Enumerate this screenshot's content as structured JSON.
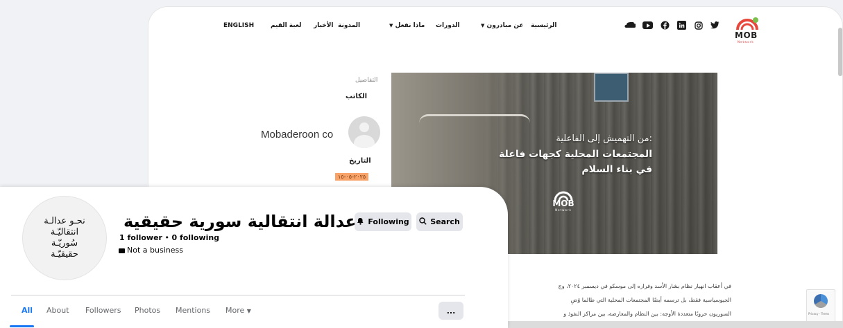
{
  "site": {
    "nav": {
      "home": "الرئيسية",
      "about": "عن مبادرون",
      "courses": "الدورات",
      "what_we_do": "ماذا نفعل",
      "blog": "المدونة",
      "news": "الأخبار",
      "values_game": "لعبة القيم",
      "english": "ENGLISH"
    },
    "logo": {
      "text": "MOB",
      "sub": "Network"
    },
    "social_icons": [
      "twitter-icon",
      "instagram-icon",
      "linkedin-icon",
      "facebook-icon",
      "youtube-icon",
      "soundcloud-icon"
    ],
    "details": {
      "section_label": "التفاصيل",
      "author_heading": "الكاتب",
      "author_name": "Mobaderoon co",
      "date_heading": "التاريخ",
      "date_value": "٢٠٢٥-٠٥-١٥"
    },
    "hero": {
      "line1": "من التهميش إلى الفاعلية:",
      "line2": "المجتمعات المحلية كجهات فاعلة",
      "line3": "في بناء السلام",
      "logo_text": "MOB",
      "logo_sub": "Network"
    },
    "article": {
      "line1": "في أعقاب انهيار نظام بشار الأسد وفراره إلى موسكو في ديسمبر ٢٠٢٤، وج",
      "line2": "الجيوسياسية فقط، بل ترسمه أيضًا المجتمعات المحلية التي طالما وُضِ",
      "line3": "السوريون حروبًا متعددة الأوجه: بين النظام والمعارضة، بين مراكز النفوذ و"
    },
    "recaptcha": {
      "text": "Privacy - Terms"
    }
  },
  "facebook": {
    "avatar_text": "نحـو عدالـة انتقاليّـة سُوريّـة حقيقيّـة",
    "page_name": "نحو عدالة انتقالية سورية حقيقية",
    "followers": "1 follower",
    "following": "0 following",
    "separator": "•",
    "business": "Not a business",
    "buttons": {
      "following": "Following",
      "search": "Search"
    },
    "tabs": [
      "All",
      "About",
      "Followers",
      "Photos",
      "Mentions",
      "More"
    ],
    "more_menu": "..."
  },
  "colors": {
    "facebook_blue": "#1877f2",
    "button_gray": "#e4e6eb",
    "date_badge": "#f7a36a",
    "logo_red": "#e8473b"
  }
}
